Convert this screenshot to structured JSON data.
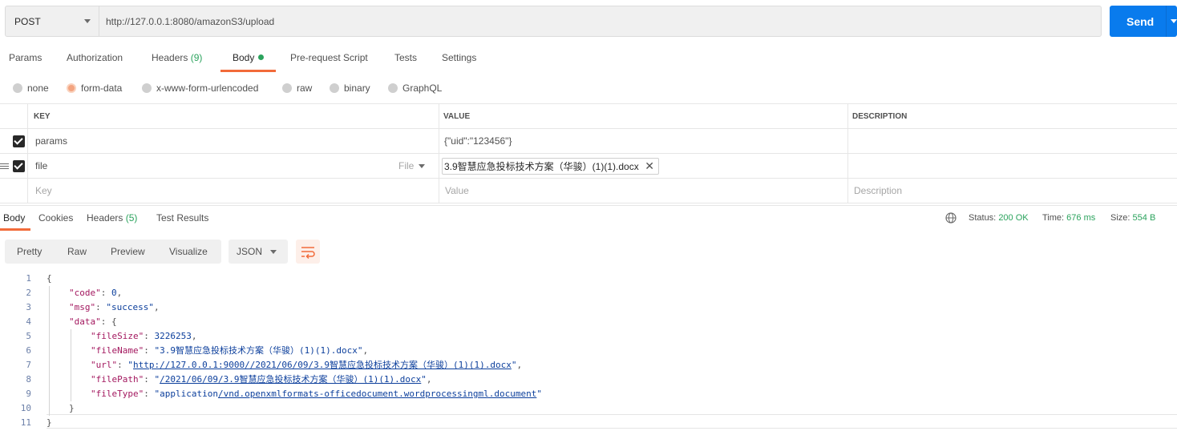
{
  "request": {
    "method": "POST",
    "url": "http://127.0.0.1:8080/amazonS3/upload",
    "send_label": "Send"
  },
  "request_tabs": {
    "params": "Params",
    "authorization": "Authorization",
    "headers": "Headers",
    "headers_count": "(9)",
    "body": "Body",
    "prerequest": "Pre-request Script",
    "tests": "Tests",
    "settings": "Settings"
  },
  "body_types": {
    "none": "none",
    "form_data": "form-data",
    "urlencoded": "x-www-form-urlencoded",
    "raw": "raw",
    "binary": "binary",
    "graphql": "GraphQL",
    "selected": "form-data"
  },
  "params_table": {
    "headers": {
      "key": "KEY",
      "value": "VALUE",
      "description": "DESCRIPTION"
    },
    "rows": [
      {
        "key": "params",
        "value": "{\"uid\":\"123456\"}",
        "checked": true
      },
      {
        "key": "file",
        "type": "File",
        "file_name": "3.9智慧应急投标技术方案（华骏）(1)(1).docx",
        "checked": true
      }
    ],
    "placeholders": {
      "key": "Key",
      "value": "Value",
      "description": "Description"
    }
  },
  "response": {
    "tabs": {
      "body": "Body",
      "cookies": "Cookies",
      "headers": "Headers",
      "headers_count": "(5)",
      "test_results": "Test Results"
    },
    "status_label": "Status:",
    "status_value": "200 OK",
    "time_label": "Time:",
    "time_value": "676 ms",
    "size_label": "Size:",
    "size_value": "554 B",
    "format_buttons": {
      "pretty": "Pretty",
      "raw": "Raw",
      "preview": "Preview",
      "visualize": "Visualize"
    },
    "format": "JSON"
  },
  "code_lines": {
    "l1": "{",
    "l2k": "\"code\"",
    "l2v": "0",
    "l3k": "\"msg\"",
    "l3v": "\"success\"",
    "l4k": "\"data\"",
    "l5k": "\"fileSize\"",
    "l5v": "3226253",
    "l6k": "\"fileName\"",
    "l6v": "\"3.9智慧应急投标技术方案（华骏）(1)(1).docx\"",
    "l7k": "\"url\"",
    "l7q": "\"",
    "l7v": "http://127.0.0.1:9000//2021/06/09/3.9智慧应急投标技术方案（华骏）(1)(1).docx",
    "l7e": "\"",
    "l8k": "\"filePath\"",
    "l8q": "\"",
    "l8v": "/2021/06/09/3.9智慧应急投标技术方案（华骏）(1)(1).docx",
    "l8e": "\"",
    "l9k": "\"fileType\"",
    "l9q": "\"application",
    "l9v": "/vnd.openxmlformats-officedocument.wordprocessingml.document",
    "l9e": "\"",
    "l10": "}",
    "l11": "}"
  },
  "colors": {
    "accent": "#f26b3a",
    "send": "#097bed",
    "success": "#2ba35d",
    "json_key": "#a3185f",
    "json_value": "#0c3f9c"
  }
}
